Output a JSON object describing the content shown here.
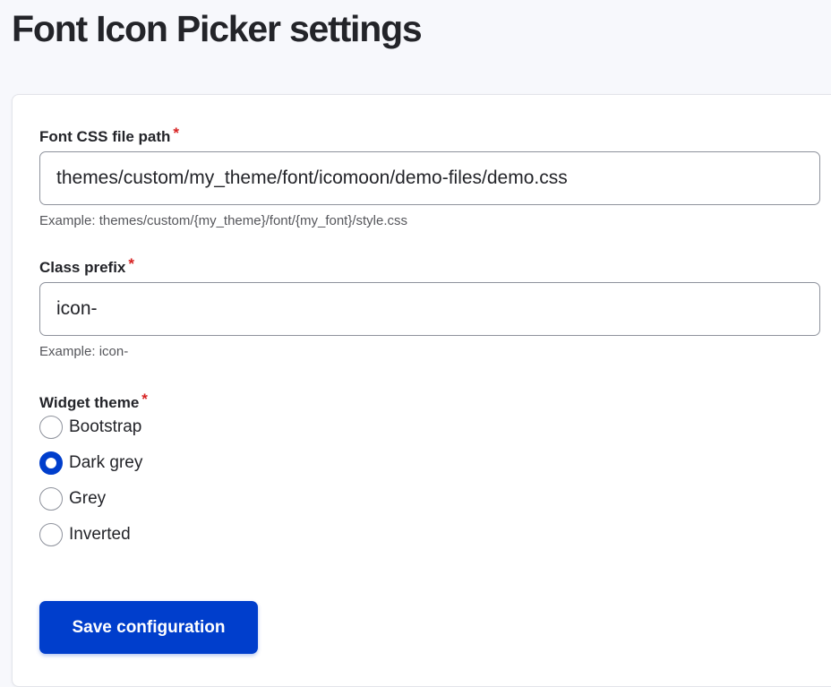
{
  "page": {
    "title": "Font Icon Picker settings"
  },
  "form": {
    "css_path": {
      "label": "Font CSS file path",
      "required_mark": "*",
      "value": "themes/custom/my_theme/font/icomoon/demo-files/demo.css",
      "description": "Example: themes/custom/{my_theme}/font/{my_font}/style.css"
    },
    "class_prefix": {
      "label": "Class prefix",
      "required_mark": "*",
      "value": "icon-",
      "description": "Example: icon-"
    },
    "widget_theme": {
      "label": "Widget theme",
      "required_mark": "*",
      "options": [
        {
          "label": "Bootstrap",
          "checked": false
        },
        {
          "label": "Dark grey",
          "checked": true
        },
        {
          "label": "Grey",
          "checked": false
        },
        {
          "label": "Inverted",
          "checked": false
        }
      ]
    },
    "save_label": "Save configuration"
  },
  "colors": {
    "accent": "#003ecc",
    "required": "#d72222",
    "background": "#f7f8fc"
  }
}
